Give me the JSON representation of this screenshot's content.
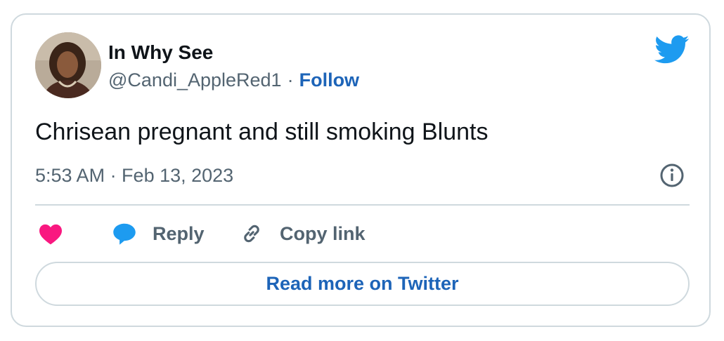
{
  "author": {
    "display_name": "In Why See",
    "handle": "@Candi_AppleRed1",
    "separator": "·",
    "follow_label": "Follow"
  },
  "tweet": {
    "text": "Chrisean pregnant and still smoking Blunts",
    "timestamp": "5:53 AM · Feb 13, 2023"
  },
  "actions": {
    "reply_label": "Reply",
    "copy_link_label": "Copy link"
  },
  "read_more_label": "Read more on Twitter",
  "icons": {
    "brand": "twitter-bird-icon",
    "info": "info-icon",
    "like": "heart-icon",
    "reply": "speech-bubble-icon",
    "copy": "link-icon"
  },
  "colors": {
    "twitter_blue": "#1d9bf0",
    "link_blue": "#1d64b8",
    "heart_pink": "#f91880",
    "text_primary": "#0f1419",
    "text_secondary": "#536471",
    "border": "#cfd9de"
  }
}
